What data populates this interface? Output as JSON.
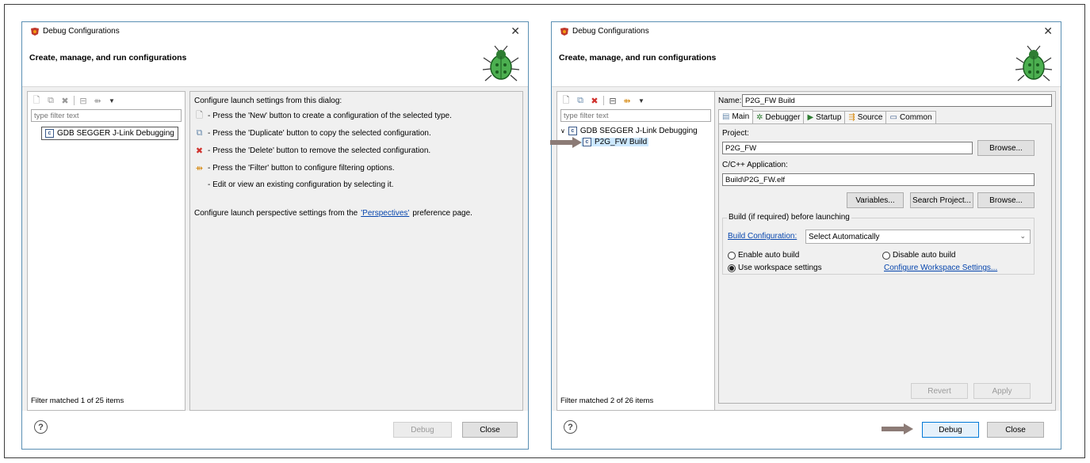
{
  "dialog1": {
    "title": "Debug Configurations",
    "banner_title": "Create, manage, and run configurations",
    "filter_placeholder": "type filter text",
    "tree": [
      {
        "label": "GDB SEGGER J-Link Debugging",
        "icon": "c-config-icon"
      }
    ],
    "filter_status": "Filter matched 1 of 25 items",
    "info": {
      "intro": "Configure launch settings from this dialog:",
      "lines": [
        {
          "icon": "new-config-icon",
          "text": "- Press the 'New' button to create a configuration of the selected type."
        },
        {
          "icon": "duplicate-icon",
          "text": "- Press the 'Duplicate' button to copy the selected configuration."
        },
        {
          "icon": "delete-icon",
          "text": "- Press the 'Delete' button to remove the selected configuration."
        },
        {
          "icon": "filter-icon",
          "text": "- Press the 'Filter' button to configure filtering options."
        },
        {
          "icon": "",
          "text": "- Edit or view an existing configuration by selecting it."
        }
      ],
      "perspectives_prefix": "Configure launch perspective settings from the ",
      "perspectives_link": "'Perspectives'",
      "perspectives_suffix": " preference page."
    },
    "buttons": {
      "debug": "Debug",
      "close": "Close"
    }
  },
  "dialog2": {
    "title": "Debug Configurations",
    "banner_title": "Create, manage, and run configurations",
    "filter_placeholder": "type filter text",
    "tree": [
      {
        "label": "GDB SEGGER J-Link Debugging",
        "icon": "c-config-icon"
      },
      {
        "label": "P2G_FW Build",
        "icon": "c-config-icon"
      }
    ],
    "filter_status": "Filter matched 2 of 26 items",
    "name_label": "Name:",
    "name_value": "P2G_FW Build",
    "tabs": [
      {
        "label": "Main",
        "icon": "main-tab-icon"
      },
      {
        "label": "Debugger",
        "icon": "debugger-tab-icon"
      },
      {
        "label": "Startup",
        "icon": "startup-tab-icon"
      },
      {
        "label": "Source",
        "icon": "source-tab-icon"
      },
      {
        "label": "Common",
        "icon": "common-tab-icon"
      }
    ],
    "project_label": "Project:",
    "project_value": "P2G_FW",
    "app_label": "C/C++ Application:",
    "app_value": "Build\\P2G_FW.elf",
    "buttons": {
      "browse": "Browse...",
      "variables": "Variables...",
      "search_project": "Search Project...",
      "browse2": "Browse...",
      "revert": "Revert",
      "apply": "Apply",
      "debug": "Debug",
      "close": "Close"
    },
    "build_group_title": "Build (if required) before launching",
    "build_config_link": "Build Configuration:",
    "build_config_value": "Select Automatically",
    "radios": {
      "enable_auto": "Enable auto build",
      "disable_auto": "Disable auto build",
      "use_workspace": "Use workspace settings",
      "selected": "use_workspace"
    },
    "configure_workspace_link": "Configure Workspace Settings..."
  },
  "colors": {
    "arrow": "#8c7b76",
    "link": "#0645ad",
    "default_button_border": "#0078d7"
  }
}
